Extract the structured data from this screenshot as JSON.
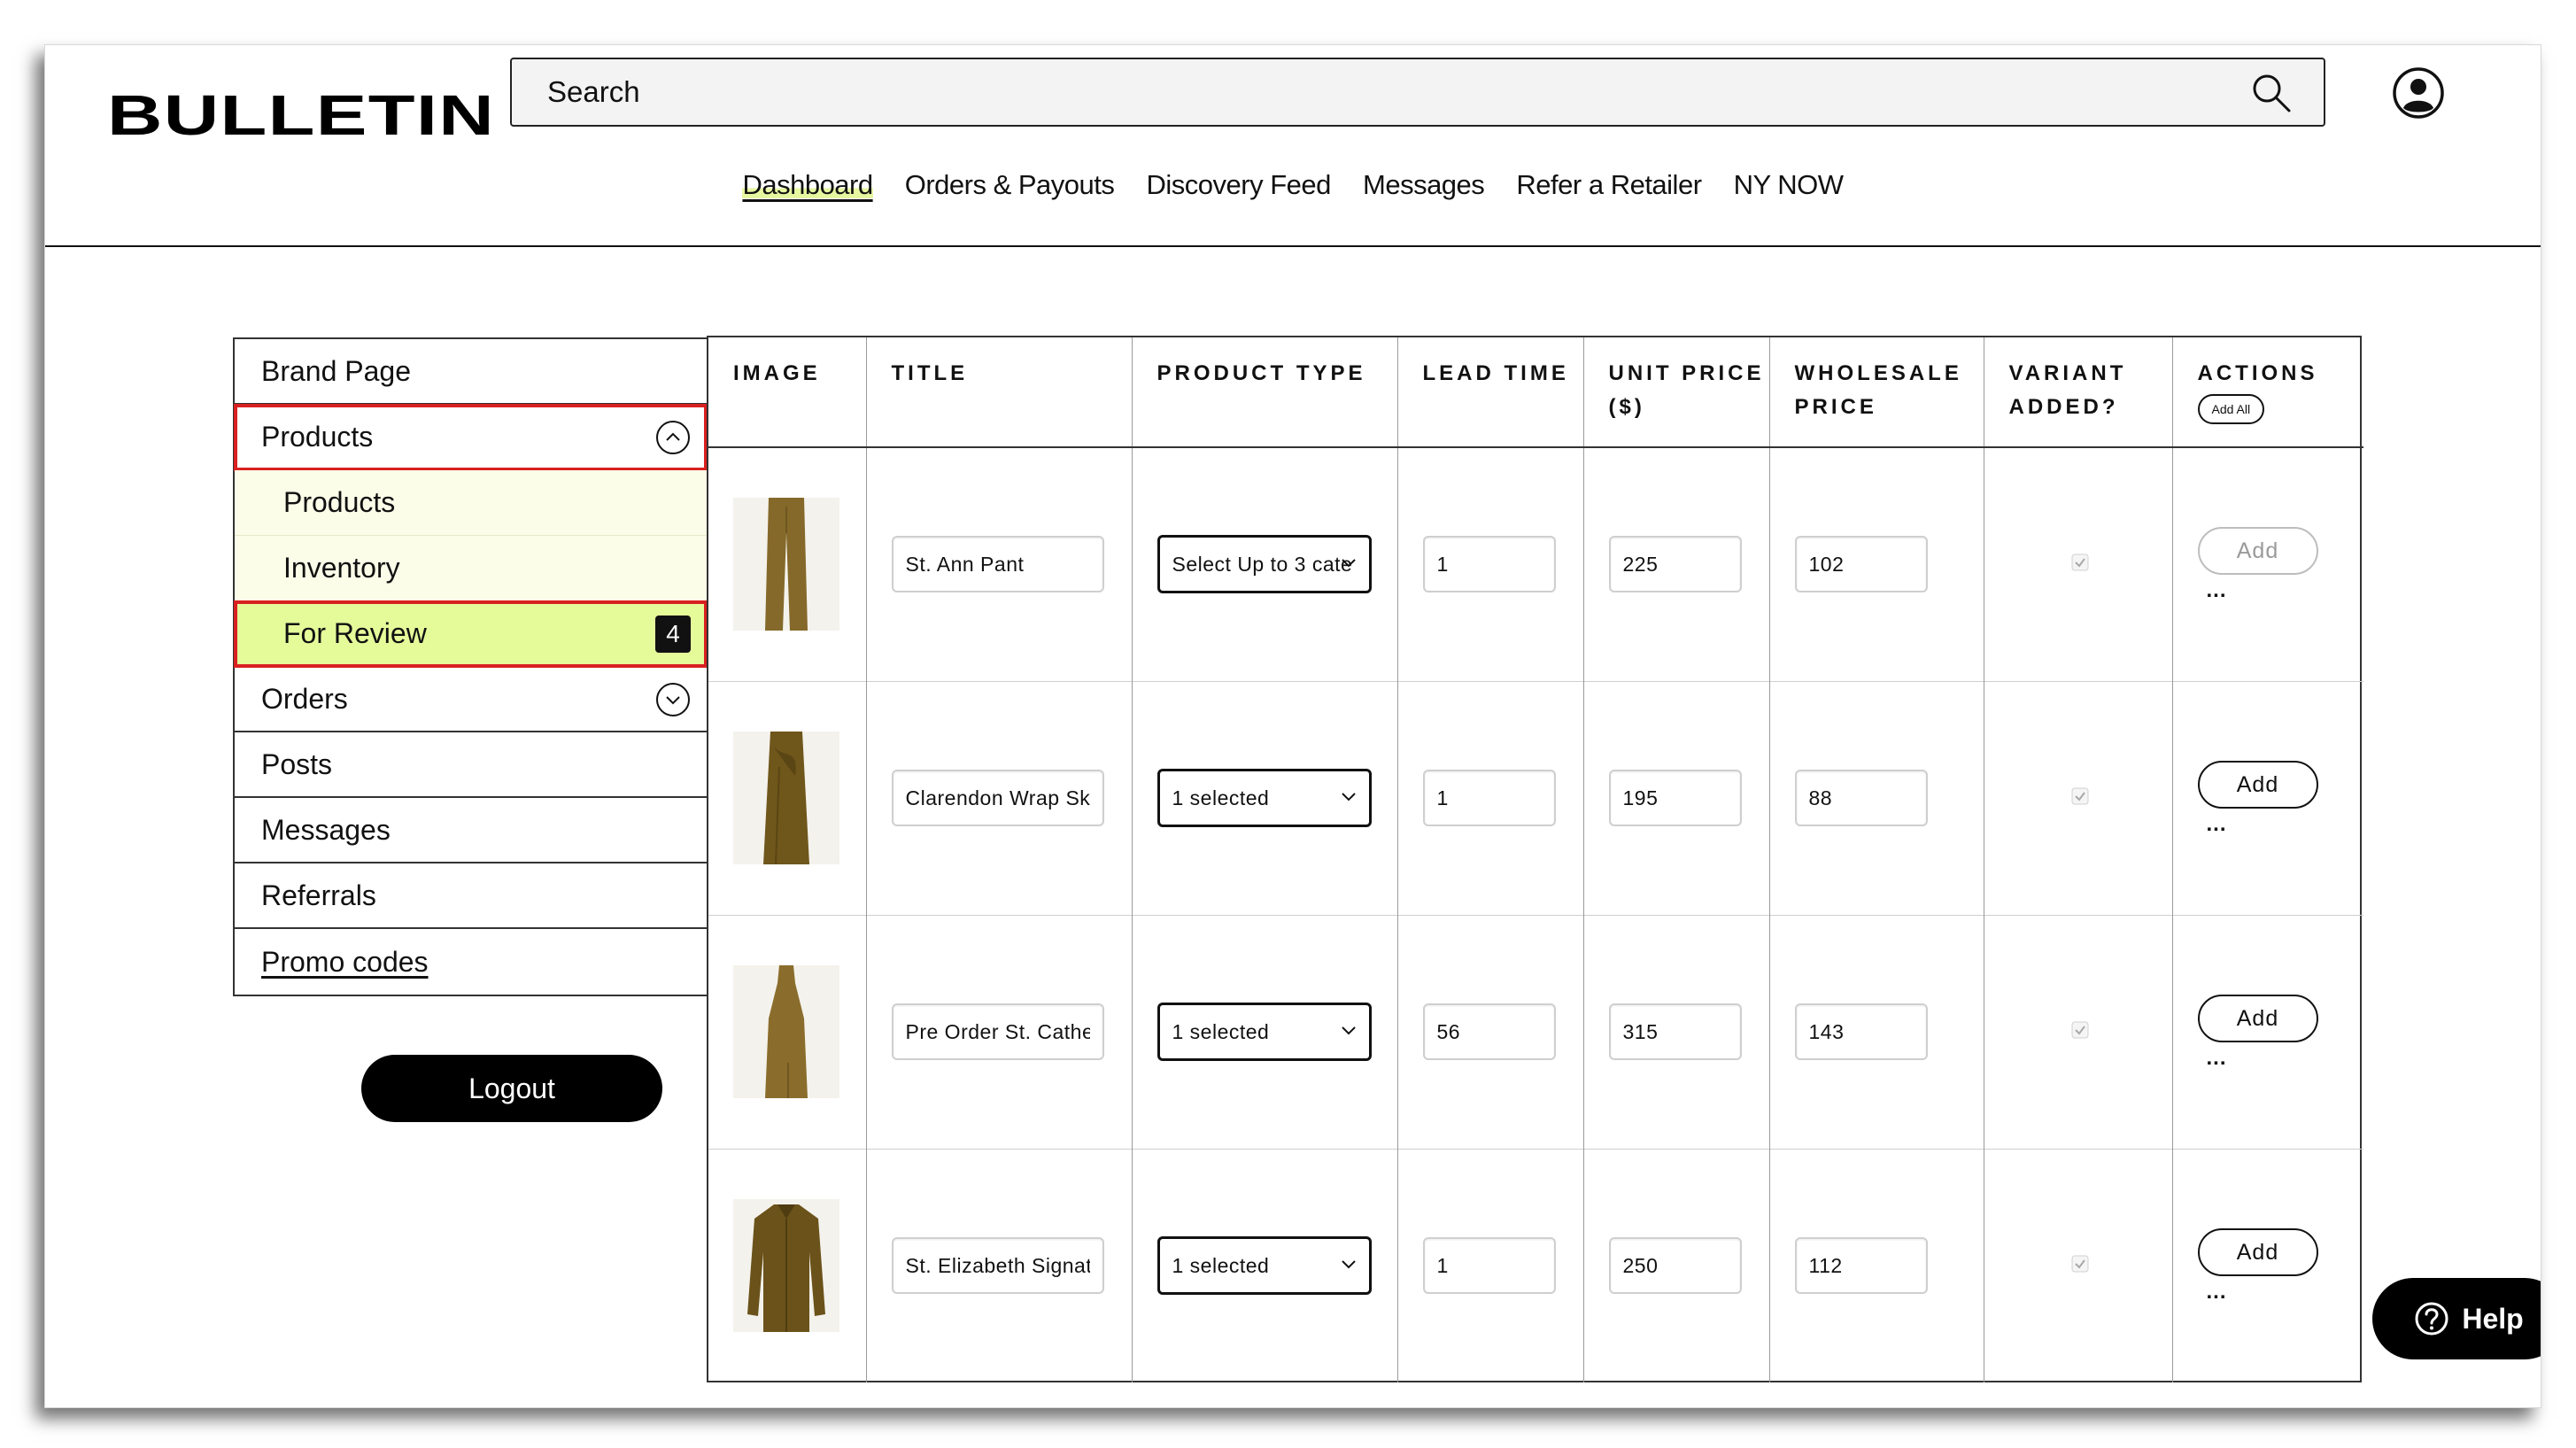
{
  "header": {
    "logo": "BULLETIN",
    "search_placeholder": "Search",
    "nav": [
      "Dashboard",
      "Orders & Payouts",
      "Discovery Feed",
      "Messages",
      "Refer a Retailer",
      "NY NOW"
    ]
  },
  "sidebar": {
    "items": [
      {
        "label": "Brand Page"
      },
      {
        "label": "Products"
      },
      {
        "label": "Products"
      },
      {
        "label": "Inventory"
      },
      {
        "label": "For Review",
        "badge": "4"
      },
      {
        "label": "Orders"
      },
      {
        "label": "Posts"
      },
      {
        "label": "Messages"
      },
      {
        "label": "Referrals"
      },
      {
        "label": "Promo codes"
      }
    ],
    "logout_label": "Logout"
  },
  "table": {
    "headers": [
      "IMAGE",
      "TITLE",
      "PRODUCT TYPE",
      "LEAD TIME",
      "UNIT PRICE ($)",
      "WHOLESALE PRICE",
      "VARIANT ADDED?",
      "ACTIONS"
    ],
    "add_all_label": "Add All",
    "rows": [
      {
        "image": "wide-leg-pant",
        "title": "St. Ann Pant",
        "product_type": "Select Up to 3 cate",
        "lead_time": "1",
        "unit_price": "225",
        "wholesale_price": "102",
        "variant_added": true,
        "action": "Add",
        "action_enabled": false,
        "more": "..."
      },
      {
        "image": "wrap-skirt",
        "title": "Clarendon Wrap Ski",
        "product_type": "1 selected",
        "lead_time": "1",
        "unit_price": "195",
        "wholesale_price": "88",
        "variant_added": true,
        "action": "Add",
        "action_enabled": true,
        "more": "..."
      },
      {
        "image": "long-dress",
        "title": "Pre Order St. Cather",
        "product_type": "1 selected",
        "lead_time": "56",
        "unit_price": "315",
        "wholesale_price": "143",
        "variant_added": true,
        "action": "Add",
        "action_enabled": true,
        "more": "..."
      },
      {
        "image": "button-shirt",
        "title": "St. Elizabeth Signatu",
        "product_type": "1 selected",
        "lead_time": "1",
        "unit_price": "250",
        "wholesale_price": "112",
        "variant_added": true,
        "action": "Add",
        "action_enabled": true,
        "more": "..."
      }
    ]
  },
  "help_label": "Help",
  "colors": {
    "accent_highlight": "#e5fb9a",
    "selection_outline": "#d92020",
    "product_olive": "#7a6425"
  }
}
